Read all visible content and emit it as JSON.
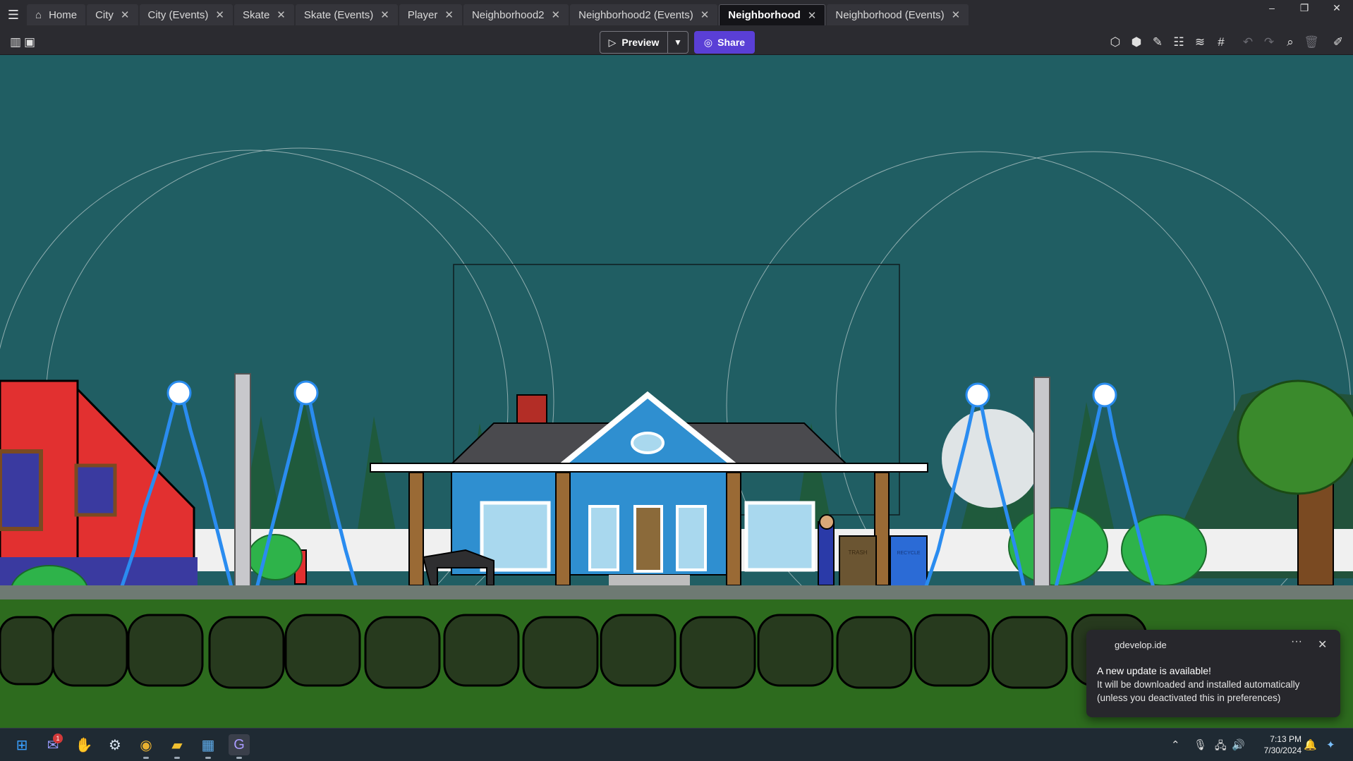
{
  "tabs": [
    {
      "label": "Home",
      "icon": "home-icon",
      "closable": false
    },
    {
      "label": "City",
      "closable": true
    },
    {
      "label": "City (Events)",
      "closable": true
    },
    {
      "label": "Skate",
      "closable": true
    },
    {
      "label": "Skate (Events)",
      "closable": true
    },
    {
      "label": "Player",
      "closable": true
    },
    {
      "label": "Neighborhood2",
      "closable": true
    },
    {
      "label": "Neighborhood2 (Events)",
      "closable": true
    },
    {
      "label": "Neighborhood",
      "closable": true,
      "active": true
    },
    {
      "label": "Neighborhood (Events)",
      "closable": true
    }
  ],
  "tab_close_glyph": "✕",
  "window_controls": {
    "minimize": "–",
    "restore": "❐",
    "close": "✕"
  },
  "toolbar": {
    "preview_label": "Preview",
    "share_label": "Share",
    "left_icons": [
      "panels-icon",
      "scene-properties-icon"
    ],
    "right_icons": [
      "object-icon",
      "object-groups-icon",
      "edit-icon",
      "instances-list-icon",
      "layers-icon",
      "grid-icon",
      "undo-icon",
      "redo-icon",
      "zoom-icon",
      "delete-icon",
      "edit-scene-icon"
    ]
  },
  "scene": {
    "name": "Neighborhood",
    "sky_color": "#205e63",
    "grass_color": "#2d6b1e",
    "house_color": "#2f8fd0",
    "red_building_color": "#e23030",
    "trash_label": "TRASH",
    "recycle_label": "RECYCLE"
  },
  "notification": {
    "source": "gdevelop.ide",
    "title": "A new update is available!",
    "body_line1": "It will be downloaded and installed automatically",
    "body_line2": "(unless you deactivated this in preferences)"
  },
  "taskbar": {
    "apps": [
      "windows-start-icon",
      "teams-icon",
      "hand-icon",
      "steam-icon",
      "chrome-icon",
      "file-explorer-icon",
      "photos-icon",
      "gdevelop-icon"
    ],
    "badge_count": "1",
    "time": "7:13 PM",
    "date": "7/30/2024"
  }
}
